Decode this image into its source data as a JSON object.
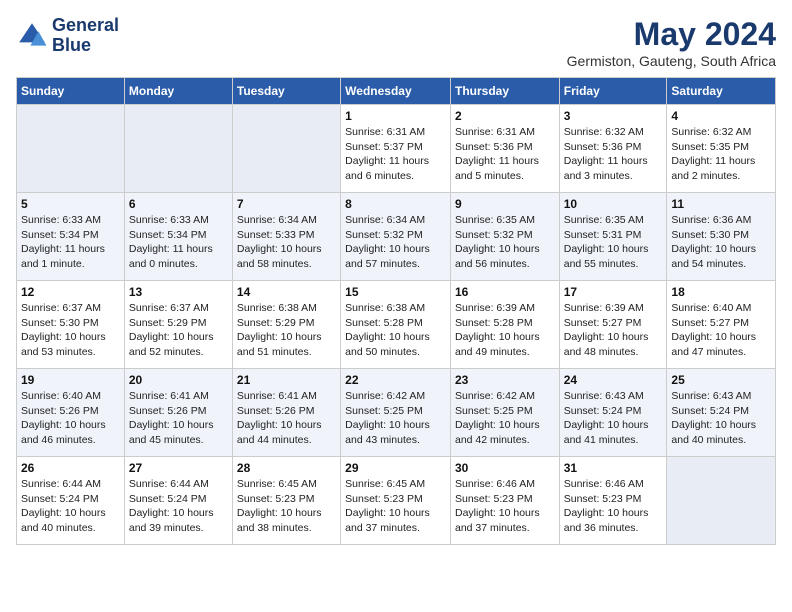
{
  "logo": {
    "line1": "General",
    "line2": "Blue"
  },
  "title": "May 2024",
  "subtitle": "Germiston, Gauteng, South Africa",
  "days_of_week": [
    "Sunday",
    "Monday",
    "Tuesday",
    "Wednesday",
    "Thursday",
    "Friday",
    "Saturday"
  ],
  "weeks": [
    [
      {
        "num": "",
        "info": ""
      },
      {
        "num": "",
        "info": ""
      },
      {
        "num": "",
        "info": ""
      },
      {
        "num": "1",
        "info": "Sunrise: 6:31 AM\nSunset: 5:37 PM\nDaylight: 11 hours and 6 minutes."
      },
      {
        "num": "2",
        "info": "Sunrise: 6:31 AM\nSunset: 5:36 PM\nDaylight: 11 hours and 5 minutes."
      },
      {
        "num": "3",
        "info": "Sunrise: 6:32 AM\nSunset: 5:36 PM\nDaylight: 11 hours and 3 minutes."
      },
      {
        "num": "4",
        "info": "Sunrise: 6:32 AM\nSunset: 5:35 PM\nDaylight: 11 hours and 2 minutes."
      }
    ],
    [
      {
        "num": "5",
        "info": "Sunrise: 6:33 AM\nSunset: 5:34 PM\nDaylight: 11 hours and 1 minute."
      },
      {
        "num": "6",
        "info": "Sunrise: 6:33 AM\nSunset: 5:34 PM\nDaylight: 11 hours and 0 minutes."
      },
      {
        "num": "7",
        "info": "Sunrise: 6:34 AM\nSunset: 5:33 PM\nDaylight: 10 hours and 58 minutes."
      },
      {
        "num": "8",
        "info": "Sunrise: 6:34 AM\nSunset: 5:32 PM\nDaylight: 10 hours and 57 minutes."
      },
      {
        "num": "9",
        "info": "Sunrise: 6:35 AM\nSunset: 5:32 PM\nDaylight: 10 hours and 56 minutes."
      },
      {
        "num": "10",
        "info": "Sunrise: 6:35 AM\nSunset: 5:31 PM\nDaylight: 10 hours and 55 minutes."
      },
      {
        "num": "11",
        "info": "Sunrise: 6:36 AM\nSunset: 5:30 PM\nDaylight: 10 hours and 54 minutes."
      }
    ],
    [
      {
        "num": "12",
        "info": "Sunrise: 6:37 AM\nSunset: 5:30 PM\nDaylight: 10 hours and 53 minutes."
      },
      {
        "num": "13",
        "info": "Sunrise: 6:37 AM\nSunset: 5:29 PM\nDaylight: 10 hours and 52 minutes."
      },
      {
        "num": "14",
        "info": "Sunrise: 6:38 AM\nSunset: 5:29 PM\nDaylight: 10 hours and 51 minutes."
      },
      {
        "num": "15",
        "info": "Sunrise: 6:38 AM\nSunset: 5:28 PM\nDaylight: 10 hours and 50 minutes."
      },
      {
        "num": "16",
        "info": "Sunrise: 6:39 AM\nSunset: 5:28 PM\nDaylight: 10 hours and 49 minutes."
      },
      {
        "num": "17",
        "info": "Sunrise: 6:39 AM\nSunset: 5:27 PM\nDaylight: 10 hours and 48 minutes."
      },
      {
        "num": "18",
        "info": "Sunrise: 6:40 AM\nSunset: 5:27 PM\nDaylight: 10 hours and 47 minutes."
      }
    ],
    [
      {
        "num": "19",
        "info": "Sunrise: 6:40 AM\nSunset: 5:26 PM\nDaylight: 10 hours and 46 minutes."
      },
      {
        "num": "20",
        "info": "Sunrise: 6:41 AM\nSunset: 5:26 PM\nDaylight: 10 hours and 45 minutes."
      },
      {
        "num": "21",
        "info": "Sunrise: 6:41 AM\nSunset: 5:26 PM\nDaylight: 10 hours and 44 minutes."
      },
      {
        "num": "22",
        "info": "Sunrise: 6:42 AM\nSunset: 5:25 PM\nDaylight: 10 hours and 43 minutes."
      },
      {
        "num": "23",
        "info": "Sunrise: 6:42 AM\nSunset: 5:25 PM\nDaylight: 10 hours and 42 minutes."
      },
      {
        "num": "24",
        "info": "Sunrise: 6:43 AM\nSunset: 5:24 PM\nDaylight: 10 hours and 41 minutes."
      },
      {
        "num": "25",
        "info": "Sunrise: 6:43 AM\nSunset: 5:24 PM\nDaylight: 10 hours and 40 minutes."
      }
    ],
    [
      {
        "num": "26",
        "info": "Sunrise: 6:44 AM\nSunset: 5:24 PM\nDaylight: 10 hours and 40 minutes."
      },
      {
        "num": "27",
        "info": "Sunrise: 6:44 AM\nSunset: 5:24 PM\nDaylight: 10 hours and 39 minutes."
      },
      {
        "num": "28",
        "info": "Sunrise: 6:45 AM\nSunset: 5:23 PM\nDaylight: 10 hours and 38 minutes."
      },
      {
        "num": "29",
        "info": "Sunrise: 6:45 AM\nSunset: 5:23 PM\nDaylight: 10 hours and 37 minutes."
      },
      {
        "num": "30",
        "info": "Sunrise: 6:46 AM\nSunset: 5:23 PM\nDaylight: 10 hours and 37 minutes."
      },
      {
        "num": "31",
        "info": "Sunrise: 6:46 AM\nSunset: 5:23 PM\nDaylight: 10 hours and 36 minutes."
      },
      {
        "num": "",
        "info": ""
      }
    ]
  ]
}
